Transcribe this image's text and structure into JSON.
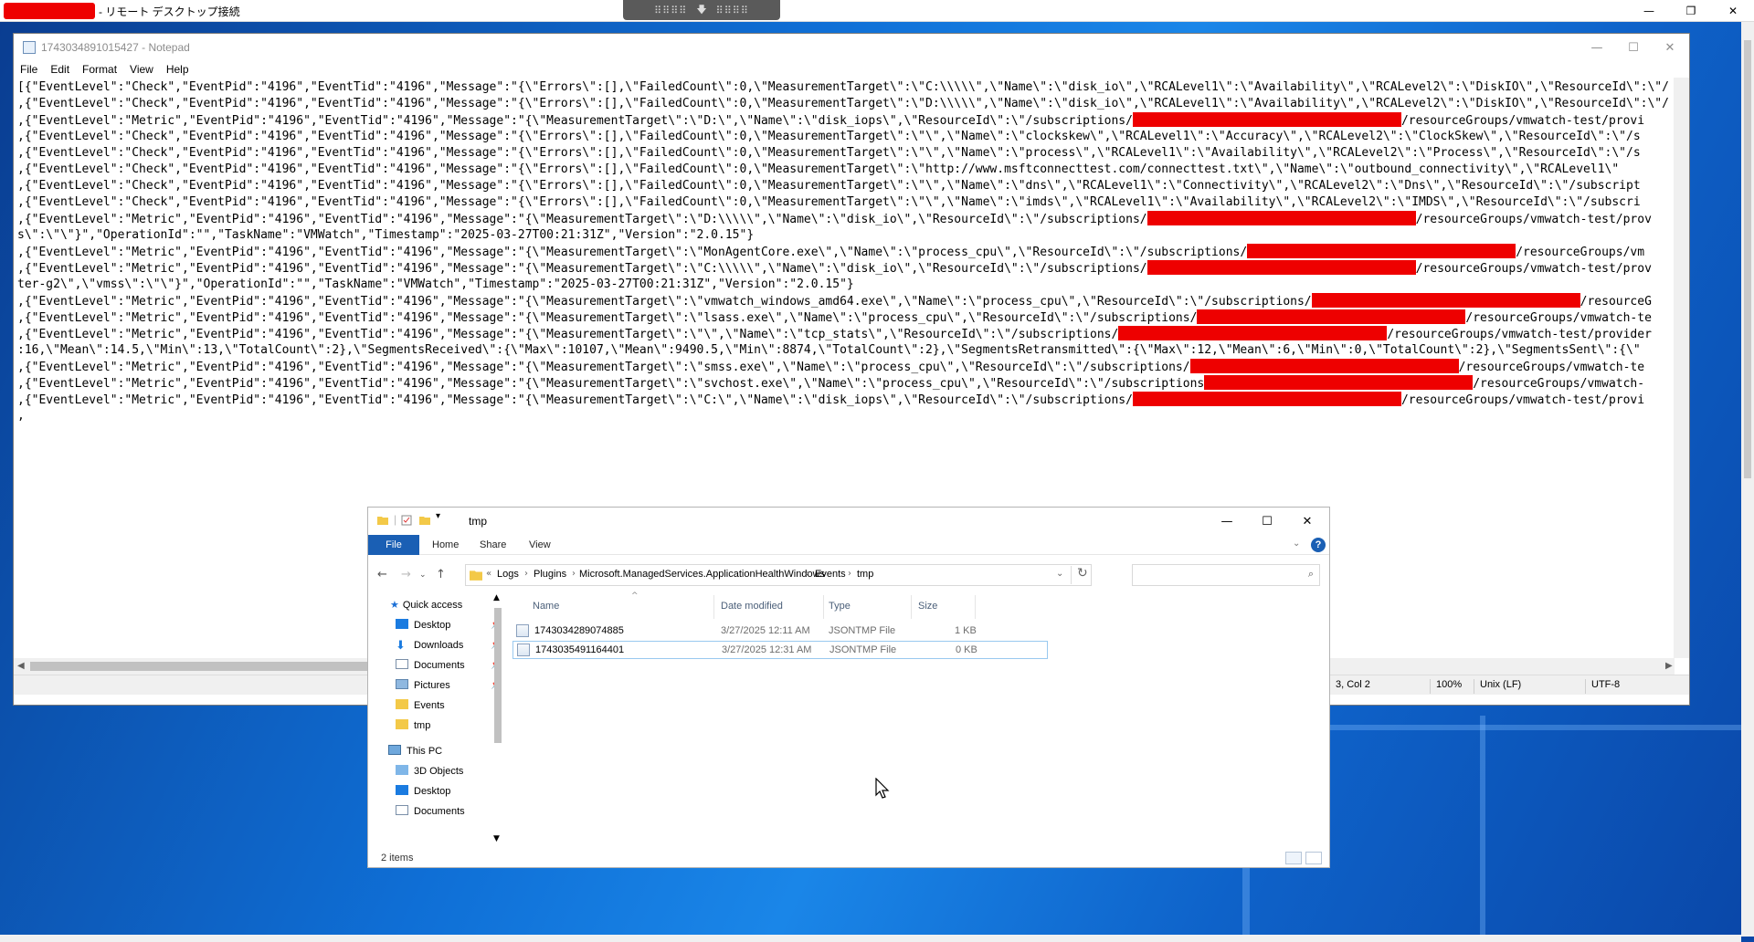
{
  "rdp": {
    "title": "- リモート デスクトップ接続",
    "connection_bar_dots": "⠿⠿⠿⠿",
    "controls": {
      "minimize": "—",
      "restore": "❐",
      "close": "✕"
    }
  },
  "notepad": {
    "title": "1743034891015427 - Notepad",
    "menu": [
      "File",
      "Edit",
      "Format",
      "View",
      "Help"
    ],
    "controls": {
      "minimize": "—",
      "maximize": "☐",
      "close": "✕"
    },
    "lines": [
      {
        "pre": "[{\"EventLevel\":\"Check\",\"EventPid\":\"4196\",\"EventTid\":\"4196\",\"Message\":\"{\\\"Errors\\\":[],\\\"FailedCount\\\":0,\\\"MeasurementTarget\\\":\\\"C:\\\\\\\\\\\",\\\"Name\\\":\\\"disk_io\\\",\\\"RCALevel1\\\":\\\"Availability\\\",\\\"RCALevel2\\\":\\\"DiskIO\\\",\\\"ResourceId\\\":\\\"/",
        "redact": false,
        "post": ""
      },
      {
        "pre": ",{\"EventLevel\":\"Check\",\"EventPid\":\"4196\",\"EventTid\":\"4196\",\"Message\":\"{\\\"Errors\\\":[],\\\"FailedCount\\\":0,\\\"MeasurementTarget\\\":\\\"D:\\\\\\\\\\\",\\\"Name\\\":\\\"disk_io\\\",\\\"RCALevel1\\\":\\\"Availability\\\",\\\"RCALevel2\\\":\\\"DiskIO\\\",\\\"ResourceId\\\":\\\"/",
        "redact": false,
        "post": ""
      },
      {
        "pre": ",{\"EventLevel\":\"Metric\",\"EventPid\":\"4196\",\"EventTid\":\"4196\",\"Message\":\"{\\\"MeasurementTarget\\\":\\\"D:\\\",\\\"Name\\\":\\\"disk_iops\\\",\\\"ResourceId\\\":\\\"/subscriptions/",
        "redact": true,
        "post": "/resourceGroups/vmwatch-test/provi"
      },
      {
        "pre": ",{\"EventLevel\":\"Check\",\"EventPid\":\"4196\",\"EventTid\":\"4196\",\"Message\":\"{\\\"Errors\\\":[],\\\"FailedCount\\\":0,\\\"MeasurementTarget\\\":\\\"\\\",\\\"Name\\\":\\\"clockskew\\\",\\\"RCALevel1\\\":\\\"Accuracy\\\",\\\"RCALevel2\\\":\\\"ClockSkew\\\",\\\"ResourceId\\\":\\\"/s",
        "redact": false,
        "post": ""
      },
      {
        "pre": ",{\"EventLevel\":\"Check\",\"EventPid\":\"4196\",\"EventTid\":\"4196\",\"Message\":\"{\\\"Errors\\\":[],\\\"FailedCount\\\":0,\\\"MeasurementTarget\\\":\\\"\\\",\\\"Name\\\":\\\"process\\\",\\\"RCALevel1\\\":\\\"Availability\\\",\\\"RCALevel2\\\":\\\"Process\\\",\\\"ResourceId\\\":\\\"/s",
        "redact": false,
        "post": ""
      },
      {
        "pre": ",{\"EventLevel\":\"Check\",\"EventPid\":\"4196\",\"EventTid\":\"4196\",\"Message\":\"{\\\"Errors\\\":[],\\\"FailedCount\\\":0,\\\"MeasurementTarget\\\":\\\"http://www.msftconnecttest.com/connecttest.txt\\\",\\\"Name\\\":\\\"outbound_connectivity\\\",\\\"RCALevel1\\\"",
        "redact": false,
        "post": ""
      },
      {
        "pre": ",{\"EventLevel\":\"Check\",\"EventPid\":\"4196\",\"EventTid\":\"4196\",\"Message\":\"{\\\"Errors\\\":[],\\\"FailedCount\\\":0,\\\"MeasurementTarget\\\":\\\"\\\",\\\"Name\\\":\\\"dns\\\",\\\"RCALevel1\\\":\\\"Connectivity\\\",\\\"RCALevel2\\\":\\\"Dns\\\",\\\"ResourceId\\\":\\\"/subscript",
        "redact": false,
        "post": ""
      },
      {
        "pre": ",{\"EventLevel\":\"Check\",\"EventPid\":\"4196\",\"EventTid\":\"4196\",\"Message\":\"{\\\"Errors\\\":[],\\\"FailedCount\\\":0,\\\"MeasurementTarget\\\":\\\"\\\",\\\"Name\\\":\\\"imds\\\",\\\"RCALevel1\\\":\\\"Availability\\\",\\\"RCALevel2\\\":\\\"IMDS\\\",\\\"ResourceId\\\":\\\"/subscri",
        "redact": false,
        "post": ""
      },
      {
        "pre": ",{\"EventLevel\":\"Metric\",\"EventPid\":\"4196\",\"EventTid\":\"4196\",\"Message\":\"{\\\"MeasurementTarget\\\":\\\"D:\\\\\\\\\\\",\\\"Name\\\":\\\"disk_io\\\",\\\"ResourceId\\\":\\\"/subscriptions/",
        "redact": true,
        "post": "/resourceGroups/vmwatch-test/prov"
      },
      {
        "pre": "s\\\":\\\"\\\"}\",\"OperationId\":\"\",\"TaskName\":\"VMWatch\",\"Timestamp\":\"2025-03-27T00:21:31Z\",\"Version\":\"2.0.15\"}",
        "redact": false,
        "post": ""
      },
      {
        "pre": ",{\"EventLevel\":\"Metric\",\"EventPid\":\"4196\",\"EventTid\":\"4196\",\"Message\":\"{\\\"MeasurementTarget\\\":\\\"MonAgentCore.exe\\\",\\\"Name\\\":\\\"process_cpu\\\",\\\"ResourceId\\\":\\\"/subscriptions/",
        "redact": true,
        "post": "/resourceGroups/vm"
      },
      {
        "pre": ",{\"EventLevel\":\"Metric\",\"EventPid\":\"4196\",\"EventTid\":\"4196\",\"Message\":\"{\\\"MeasurementTarget\\\":\\\"C:\\\\\\\\\\\",\\\"Name\\\":\\\"disk_io\\\",\\\"ResourceId\\\":\\\"/subscriptions/",
        "redact": true,
        "post": "/resourceGroups/vmwatch-test/prov"
      },
      {
        "pre": "ter-g2\\\",\\\"vmss\\\":\\\"\\\"}\",\"OperationId\":\"\",\"TaskName\":\"VMWatch\",\"Timestamp\":\"2025-03-27T00:21:31Z\",\"Version\":\"2.0.15\"}",
        "redact": false,
        "post": ""
      },
      {
        "pre": ",{\"EventLevel\":\"Metric\",\"EventPid\":\"4196\",\"EventTid\":\"4196\",\"Message\":\"{\\\"MeasurementTarget\\\":\\\"vmwatch_windows_amd64.exe\\\",\\\"Name\\\":\\\"process_cpu\\\",\\\"ResourceId\\\":\\\"/subscriptions/",
        "redact": true,
        "post": "/resourceG"
      },
      {
        "pre": ",{\"EventLevel\":\"Metric\",\"EventPid\":\"4196\",\"EventTid\":\"4196\",\"Message\":\"{\\\"MeasurementTarget\\\":\\\"lsass.exe\\\",\\\"Name\\\":\\\"process_cpu\\\",\\\"ResourceId\\\":\\\"/subscriptions/",
        "redact": true,
        "post": "/resourceGroups/vmwatch-te"
      },
      {
        "pre": ",{\"EventLevel\":\"Metric\",\"EventPid\":\"4196\",\"EventTid\":\"4196\",\"Message\":\"{\\\"MeasurementTarget\\\":\\\"\\\",\\\"Name\\\":\\\"tcp_stats\\\",\\\"ResourceId\\\":\\\"/subscriptions/",
        "redact": true,
        "post": "/resourceGroups/vmwatch-test/provider"
      },
      {
        "pre": ":16,\\\"Mean\\\":14.5,\\\"Min\\\":13,\\\"TotalCount\\\":2},\\\"SegmentsReceived\\\":{\\\"Max\\\":10107,\\\"Mean\\\":9490.5,\\\"Min\\\":8874,\\\"TotalCount\\\":2},\\\"SegmentsRetransmitted\\\":{\\\"Max\\\":12,\\\"Mean\\\":6,\\\"Min\\\":0,\\\"TotalCount\\\":2},\\\"SegmentsSent\\\":{\\\"",
        "redact": false,
        "post": ""
      },
      {
        "pre": ",{\"EventLevel\":\"Metric\",\"EventPid\":\"4196\",\"EventTid\":\"4196\",\"Message\":\"{\\\"MeasurementTarget\\\":\\\"smss.exe\\\",\\\"Name\\\":\\\"process_cpu\\\",\\\"ResourceId\\\":\\\"/subscriptions/",
        "redact": true,
        "post": "/resourceGroups/vmwatch-te"
      },
      {
        "pre": ",{\"EventLevel\":\"Metric\",\"EventPid\":\"4196\",\"EventTid\":\"4196\",\"Message\":\"{\\\"MeasurementTarget\\\":\\\"svchost.exe\\\",\\\"Name\\\":\\\"process_cpu\\\",\\\"ResourceId\\\":\\\"/subscriptions",
        "redact": true,
        "post": "/resourceGroups/vmwatch-"
      },
      {
        "pre": ",{\"EventLevel\":\"Metric\",\"EventPid\":\"4196\",\"EventTid\":\"4196\",\"Message\":\"{\\\"MeasurementTarget\\\":\\\"C:\\\",\\\"Name\\\":\\\"disk_iops\\\",\\\"ResourceId\\\":\\\"/subscriptions/",
        "redact": true,
        "post": "/resourceGroups/vmwatch-test/provi"
      },
      {
        "pre": ",",
        "redact": false,
        "post": ""
      }
    ],
    "status": {
      "position": "3, Col 2",
      "zoom": "100%",
      "line_ending": "Unix (LF)",
      "encoding": "UTF-8"
    }
  },
  "explorer": {
    "title": "tmp",
    "controls": {
      "minimize": "—",
      "maximize": "☐",
      "close": "✕"
    },
    "ribbon_tabs": [
      "File",
      "Home",
      "Share",
      "View"
    ],
    "help": "?",
    "breadcrumb": [
      "Logs",
      "Plugins",
      "Microsoft.ManagedServices.ApplicationHealthWindows",
      "Events",
      "tmp"
    ],
    "breadcrumb_prefix": "«",
    "search_placeholder": "",
    "nav": {
      "quick_access": "Quick access",
      "items": [
        {
          "label": "Desktop",
          "icon": "desktop-icon",
          "pinned": true
        },
        {
          "label": "Downloads",
          "icon": "downloads-icon",
          "pinned": true
        },
        {
          "label": "Documents",
          "icon": "documents-icon",
          "pinned": true
        },
        {
          "label": "Pictures",
          "icon": "pictures-icon",
          "pinned": true
        },
        {
          "label": "Events",
          "icon": "folder-icon",
          "pinned": false
        },
        {
          "label": "tmp",
          "icon": "folder-icon",
          "pinned": false
        }
      ],
      "this_pc": "This PC",
      "pc_items": [
        {
          "label": "3D Objects",
          "icon": "3d-objects-icon"
        },
        {
          "label": "Desktop",
          "icon": "desktop-icon"
        },
        {
          "label": "Documents",
          "icon": "documents-icon"
        }
      ]
    },
    "columns": [
      "Name",
      "Date modified",
      "Type",
      "Size"
    ],
    "files": [
      {
        "name": "1743034289074885",
        "date": "3/27/2025 12:11 AM",
        "type": "JSONTMP File",
        "size": "1 KB",
        "selected": false
      },
      {
        "name": "1743035491164401",
        "date": "3/27/2025 12:31 AM",
        "type": "JSONTMP File",
        "size": "0 KB",
        "selected": true
      }
    ],
    "status": "2 items"
  },
  "colors": {
    "redaction": "#ee0000",
    "ribbon_file": "#1a5fb4",
    "desktop_blue": "#0f6fd6"
  }
}
